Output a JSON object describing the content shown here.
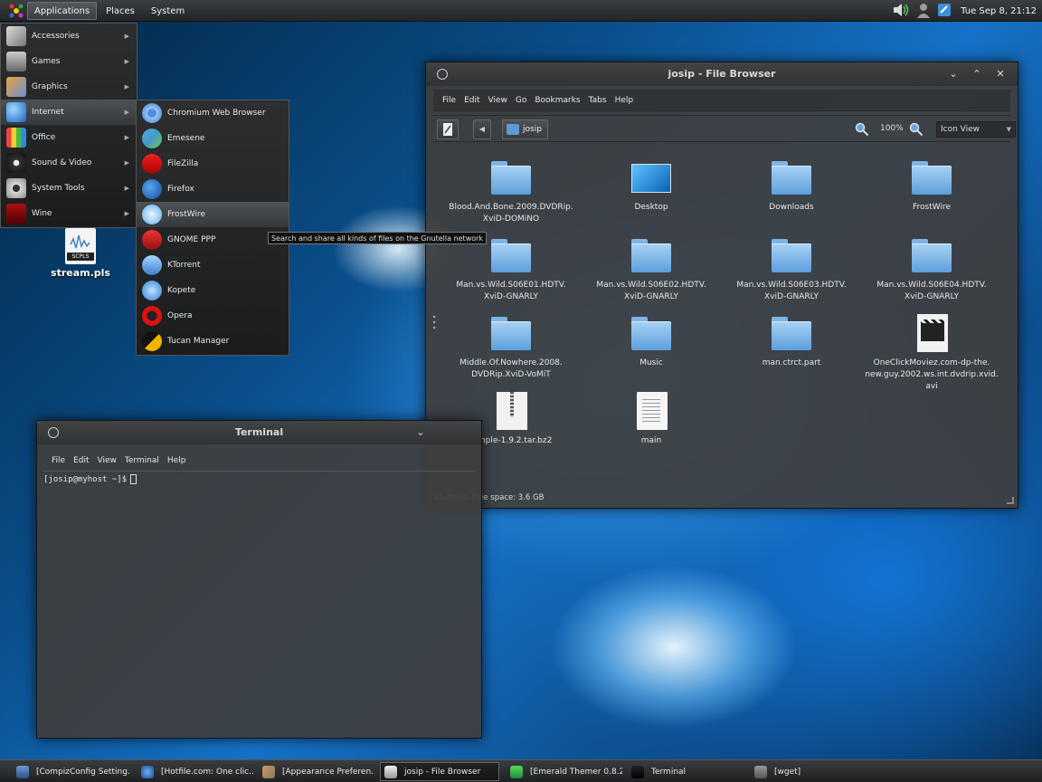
{
  "top_panel": {
    "menus": [
      "Applications",
      "Places",
      "System"
    ],
    "clock": "Tue Sep  8, 21:12",
    "tray_icons": [
      "volume-icon",
      "user-icon",
      "notification-icon"
    ]
  },
  "desktop": {
    "icon_tag": "SCPLS",
    "icon_label": "stream.pls"
  },
  "app_menu": {
    "items": [
      {
        "label": "Accessories",
        "icon": "accessories-icon"
      },
      {
        "label": "Games",
        "icon": "gamepad-icon"
      },
      {
        "label": "Graphics",
        "icon": "graphics-icon"
      },
      {
        "label": "Internet",
        "icon": "globe-icon"
      },
      {
        "label": "Office",
        "icon": "office-icon"
      },
      {
        "label": "Sound & Video",
        "icon": "sound-video-icon"
      },
      {
        "label": "System Tools",
        "icon": "gear-icon"
      },
      {
        "label": "Wine",
        "icon": "wine-icon"
      }
    ],
    "active_index": 3
  },
  "internet_menu": {
    "items": [
      {
        "label": "Chromium Web Browser",
        "icon": "chromium-icon"
      },
      {
        "label": "Emesene",
        "icon": "emesene-icon"
      },
      {
        "label": "FileZilla",
        "icon": "filezilla-icon"
      },
      {
        "label": "Firefox",
        "icon": "firefox-icon"
      },
      {
        "label": "FrostWire",
        "icon": "frostwire-icon"
      },
      {
        "label": "GNOME PPP",
        "icon": "phone-icon"
      },
      {
        "label": "KTorrent",
        "icon": "ktorrent-icon"
      },
      {
        "label": "Kopete",
        "icon": "kopete-icon"
      },
      {
        "label": "Opera",
        "icon": "opera-icon"
      },
      {
        "label": "Tucan Manager",
        "icon": "tucan-icon"
      }
    ],
    "hovered_index": 4,
    "tooltip": "Search and share all kinds of files on the Gnutella network"
  },
  "file_browser": {
    "title": "josip - File Browser",
    "menus": [
      "File",
      "Edit",
      "View",
      "Go",
      "Bookmarks",
      "Tabs",
      "Help"
    ],
    "location": "josip",
    "zoom": "100%",
    "view_mode": "Icon View",
    "files": [
      {
        "name": "Blood.And.Bone.2009.DVDRip.\nXviD-DOMiNO",
        "type": "folder"
      },
      {
        "name": "Desktop",
        "type": "desktop"
      },
      {
        "name": "Downloads",
        "type": "folder"
      },
      {
        "name": "FrostWire",
        "type": "folder"
      },
      {
        "name": "Man.vs.Wild.S06E01.HDTV.\nXviD-GNARLY",
        "type": "folder"
      },
      {
        "name": "Man.vs.Wild.S06E02.HDTV.\nXviD-GNARLY",
        "type": "folder"
      },
      {
        "name": "Man.vs.Wild.S06E03.HDTV.\nXviD-GNARLY",
        "type": "folder"
      },
      {
        "name": "Man.vs.Wild.S06E04.HDTV.\nXviD-GNARLY",
        "type": "folder"
      },
      {
        "name": "Middle.Of.Nowhere.2008.\nDVDRip.XviD-VoMiT",
        "type": "folder"
      },
      {
        "name": "Music",
        "type": "folder"
      },
      {
        "name": "man.ctrct.part",
        "type": "folder"
      },
      {
        "name": "OneClickMoviez.com-dp-the.\nnew.guy.2002.ws.int.dvdrip.xvid.\navi",
        "type": "video"
      },
      {
        "name": "Simple-1.9.2.tar.bz2",
        "type": "tar"
      },
      {
        "name": "main",
        "type": "doc"
      }
    ],
    "status": "14 items, Free space: 3.6 GB"
  },
  "terminal": {
    "title": "Terminal",
    "menus": [
      "File",
      "Edit",
      "View",
      "Terminal",
      "Help"
    ],
    "prompt": "[josip@myhost ~]$"
  },
  "taskbar": {
    "tasks": [
      {
        "label": "[CompizConfig Setting...",
        "icon": "compiz-icon",
        "active": false
      },
      {
        "label": "[Hotfile.com: One clic...",
        "icon": "browser-icon",
        "active": false
      },
      {
        "label": "[Appearance Preferen...",
        "icon": "appearance-icon",
        "active": false
      },
      {
        "label": "josip - File Browser",
        "icon": "file-browser-icon",
        "active": true
      },
      {
        "label": "[Emerald Themer 0.8.2]",
        "icon": "emerald-icon",
        "active": false
      },
      {
        "label": "Terminal",
        "icon": "terminal-icon",
        "active": false
      },
      {
        "label": "[wget]",
        "icon": "wget-icon",
        "active": false
      }
    ]
  },
  "colors": {
    "folder": "#5d9fdc",
    "panel": "#2b2d2f",
    "window": "#3e3e3e",
    "wallpaper_accent": "#1672c8"
  }
}
